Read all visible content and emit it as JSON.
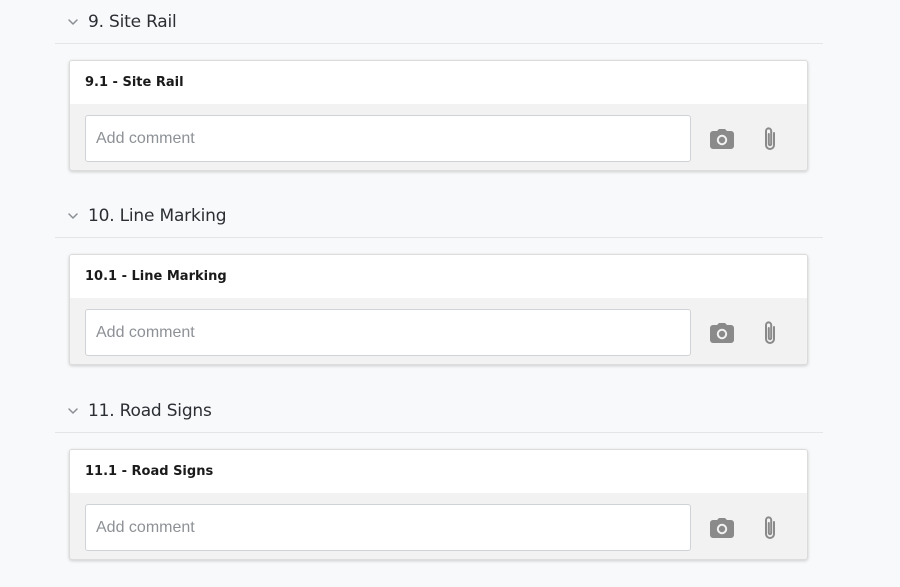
{
  "sections": [
    {
      "title": "9. Site Rail",
      "items": [
        {
          "title": "9.1 - Site Rail",
          "comment_placeholder": "Add comment",
          "comment_value": ""
        }
      ]
    },
    {
      "title": "10. Line Marking",
      "items": [
        {
          "title": "10.1 - Line Marking",
          "comment_placeholder": "Add comment",
          "comment_value": ""
        }
      ]
    },
    {
      "title": "11. Road Signs",
      "items": [
        {
          "title": "11.1 - Road Signs",
          "comment_placeholder": "Add comment",
          "comment_value": ""
        }
      ]
    }
  ],
  "icons": {
    "section_toggle": "chevron-down-icon",
    "photo": "camera-icon",
    "attach": "paperclip-icon"
  },
  "colors": {
    "background": "#f8f9fa",
    "card_body": "#f2f2f2",
    "icon": "#8a8a8a"
  }
}
